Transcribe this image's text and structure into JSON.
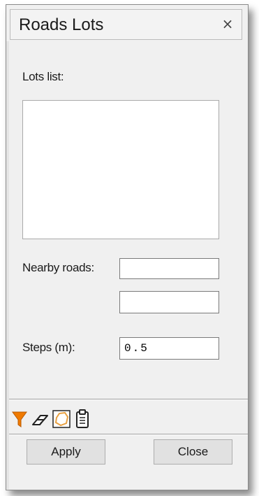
{
  "window": {
    "title": "Roads Lots",
    "close_glyph": "×"
  },
  "form": {
    "lots_list_label": "Lots list:",
    "nearby_roads_label": "Nearby roads:",
    "nearby_road_1": "",
    "nearby_road_2": "",
    "steps_label": "Steps (m):",
    "steps_value": "0.5"
  },
  "toolbar": {
    "icons": [
      "filter-icon",
      "eraser-icon",
      "polygon-select-icon",
      "clipboard-icon"
    ],
    "filter_color": "#f07a00",
    "polygon_color": "#e8a040"
  },
  "buttons": {
    "apply_label": "Apply",
    "close_label": "Close"
  }
}
